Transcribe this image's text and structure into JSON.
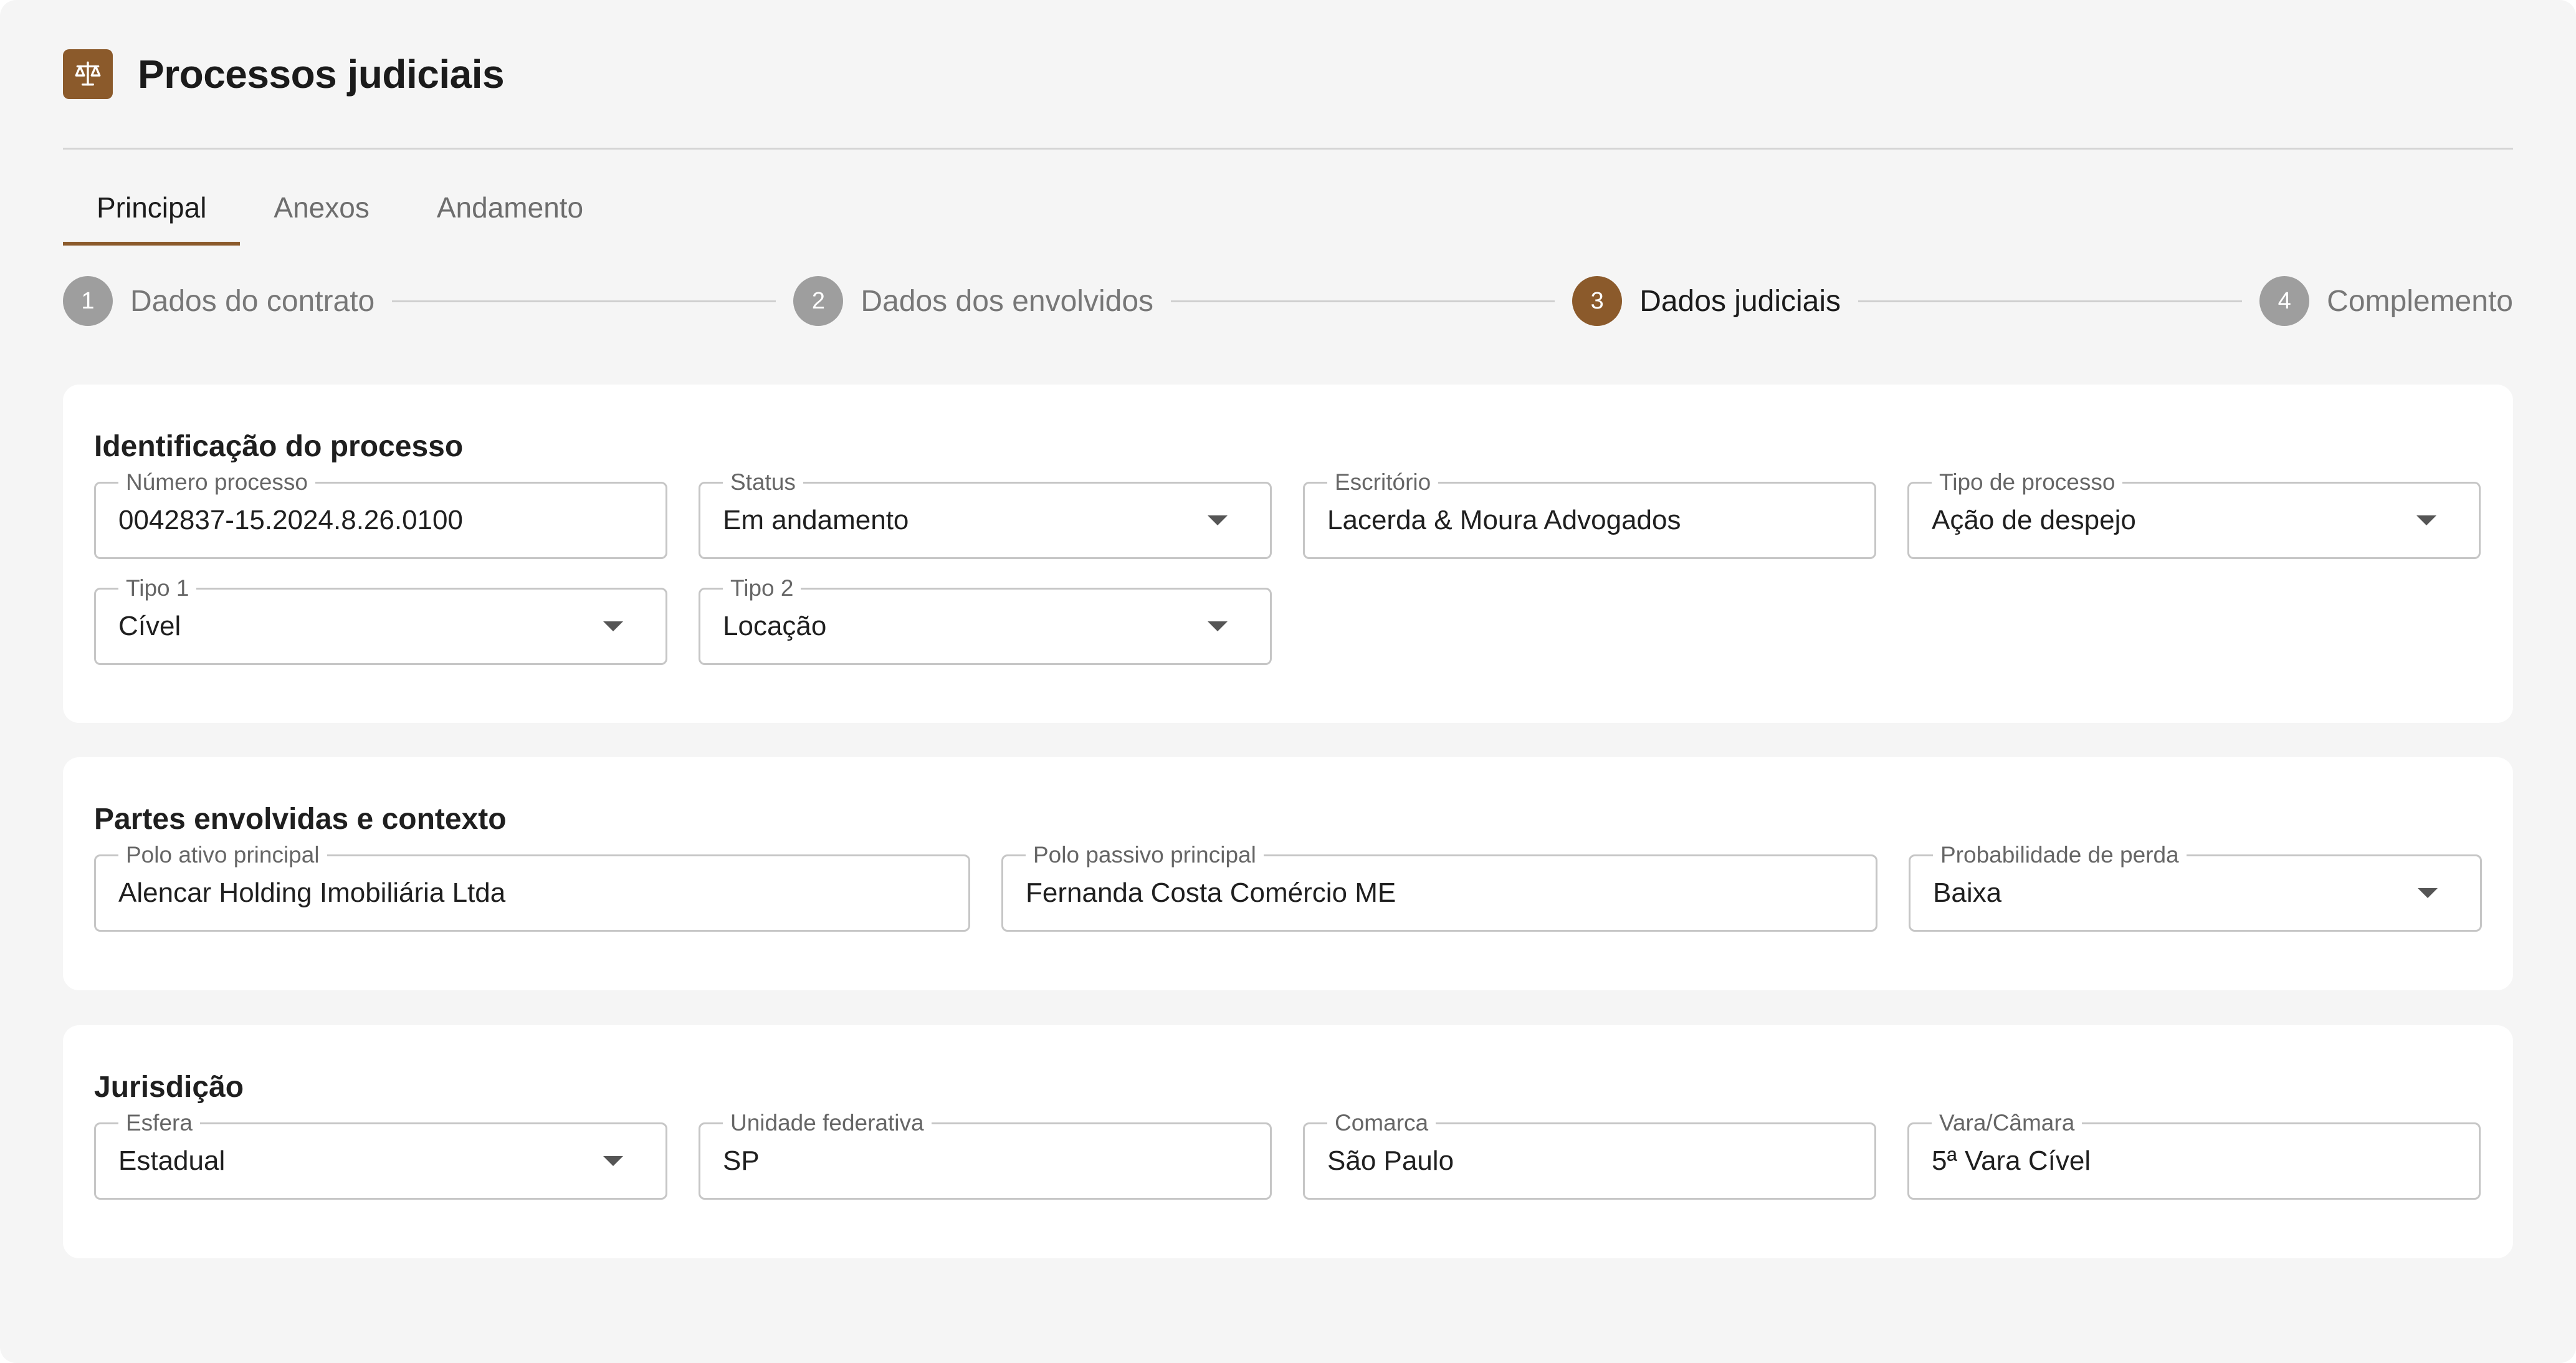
{
  "header": {
    "title": "Processos judiciais",
    "logo_icon": "scale-balance-icon"
  },
  "colors": {
    "accent": "#8b5a2b",
    "background": "#f5f5f5"
  },
  "tabs": [
    {
      "label": "Principal",
      "active": true
    },
    {
      "label": "Anexos",
      "active": false
    },
    {
      "label": "Andamento",
      "active": false
    }
  ],
  "steps": [
    {
      "num": "1",
      "label": "Dados do contrato",
      "active": false
    },
    {
      "num": "2",
      "label": "Dados dos envolvidos",
      "active": false
    },
    {
      "num": "3",
      "label": "Dados judiciais",
      "active": true
    },
    {
      "num": "4",
      "label": "Complemento",
      "active": false
    }
  ],
  "identificacao": {
    "title": "Identificação do processo",
    "numero": {
      "label": "Número processo",
      "value": "0042837-15.2024.8.26.0100"
    },
    "status": {
      "label": "Status",
      "value": "Em andamento"
    },
    "escritorio": {
      "label": "Escritório",
      "value": "Lacerda & Moura Advogados"
    },
    "tipo_processo": {
      "label": "Tipo de processo",
      "value": "Ação de despejo"
    },
    "tipo1": {
      "label": "Tipo 1",
      "value": "Cível"
    },
    "tipo2": {
      "label": "Tipo 2",
      "value": "Locação"
    }
  },
  "partes": {
    "title": "Partes envolvidas e contexto",
    "polo_ativo": {
      "label": "Polo ativo principal",
      "value": "Alencar Holding Imobiliária Ltda"
    },
    "polo_passivo": {
      "label": "Polo passivo principal",
      "value": "Fernanda Costa Comércio ME"
    },
    "probabilidade": {
      "label": "Probabilidade de perda",
      "value": "Baixa"
    }
  },
  "jurisdicao": {
    "title": "Jurisdição",
    "esfera": {
      "label": "Esfera",
      "value": "Estadual"
    },
    "uf": {
      "label": "Unidade federativa",
      "value": "SP"
    },
    "comarca": {
      "label": "Comarca",
      "value": "São Paulo"
    },
    "vara": {
      "label": "Vara/Câmara",
      "value": "5ª Vara Cível"
    }
  }
}
